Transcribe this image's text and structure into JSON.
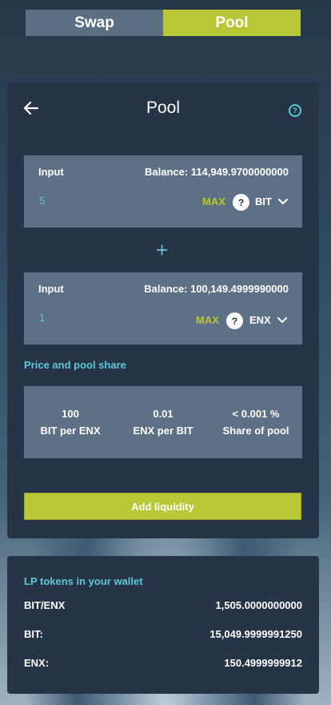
{
  "tabs": {
    "swap": "Swap",
    "pool": "Pool"
  },
  "header": {
    "title": "Pool",
    "help_glyph": "?"
  },
  "input1": {
    "label": "Input",
    "balance": "Balance: 114,949.9700000000",
    "value": "5",
    "max": "MAX",
    "token_icon": "?",
    "token": "BIT"
  },
  "input2": {
    "label": "Input",
    "balance": "Balance: 100,149.4999990000",
    "value": "1",
    "max": "MAX",
    "token_icon": "?",
    "token": "ENX"
  },
  "plus": "+",
  "price_section": {
    "title": "Price and pool share",
    "stats": [
      {
        "value": "100",
        "label": "BIT per ENX"
      },
      {
        "value": "0.01",
        "label": "ENX per BIT"
      },
      {
        "value": "< 0.001 %",
        "label": "Share of pool"
      }
    ]
  },
  "add_button": "Add liquidity",
  "lp": {
    "title": "LP tokens in your wallet",
    "rows": [
      {
        "key": "BIT/ENX",
        "value": "1,505.0000000000"
      },
      {
        "key": "BIT:",
        "value": "15,049.9999991250"
      },
      {
        "key": "ENX:",
        "value": "150.4999999912"
      }
    ]
  },
  "colors": {
    "accent_green": "#b7c735",
    "accent_cyan": "#5ec7d6",
    "card_bg": "#273447",
    "field_bg": "#5d7085"
  }
}
